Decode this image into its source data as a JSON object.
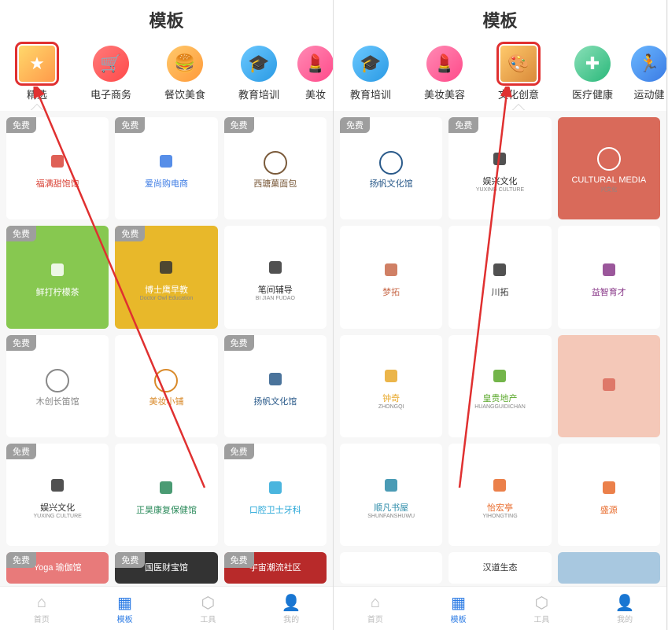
{
  "left": {
    "title": "模板",
    "categories": [
      {
        "label": "精选",
        "color": "linear-gradient(135deg,#ffd86b,#ff9a4a)",
        "glyph": "★",
        "selected": true
      },
      {
        "label": "电子商务",
        "color": "linear-gradient(135deg,#ff7a7a,#ff4a4a)",
        "glyph": "🛒"
      },
      {
        "label": "餐饮美食",
        "color": "linear-gradient(135deg,#ffc96b,#ff9a3a)",
        "glyph": "🍔"
      },
      {
        "label": "教育培训",
        "color": "linear-gradient(135deg,#6bc8ff,#2a9ae4)",
        "glyph": "🎓"
      },
      {
        "label": "美妆",
        "color": "linear-gradient(135deg,#ff8ab4,#ff4a8a)",
        "glyph": "💄",
        "partial": true
      }
    ],
    "free_badge": "免费",
    "cards": [
      {
        "bg": "#fff",
        "title": "福满甜饱饱",
        "accent": "#d94438",
        "badge": true
      },
      {
        "bg": "#fff",
        "title": "爱尚购电商",
        "accent": "#3a7ae4",
        "badge": true
      },
      {
        "bg": "#fff",
        "title": "西瑭菓面包",
        "accent": "#7a5a3a",
        "badge": true,
        "circle": true
      },
      {
        "bg": "#87c850",
        "title": "鲜打柠檬茶",
        "accent": "#fff",
        "badge": true
      },
      {
        "bg": "#e8b82a",
        "title": "博士鹰早教",
        "sub": "Doctor Owl Education",
        "accent": "#333",
        "badge": true
      },
      {
        "bg": "#fff",
        "title": "笔间辅导",
        "sub": "BI JIAN FUDAO",
        "accent": "#333"
      },
      {
        "bg": "#fff",
        "title": "木创长笛馆",
        "accent": "#888",
        "badge": true,
        "circle": true
      },
      {
        "bg": "#fff",
        "title": "美妆小铺",
        "accent": "#d98a2a",
        "circle": true
      },
      {
        "bg": "#fff",
        "title": "扬帆文化馆",
        "accent": "#2a5a8a",
        "badge": true
      },
      {
        "bg": "#fff",
        "title": "娱兴文化",
        "sub": "YUXING CULTURE",
        "accent": "#333",
        "badge": true
      },
      {
        "bg": "#fff",
        "title": "正昊康复保健馆",
        "accent": "#2a8a5a"
      },
      {
        "bg": "#fff",
        "title": "口腔卫士牙科",
        "accent": "#2aa8d8",
        "badge": true
      },
      {
        "bg": "#e87a7a",
        "title": "Yoga 瑜伽馆",
        "accent": "#fff",
        "badge": true,
        "short": true
      },
      {
        "bg": "#333",
        "title": "国医财宝馆",
        "accent": "#e8b82a",
        "badge": true,
        "short": true
      },
      {
        "bg": "#b82a2a",
        "title": "宇宙潮流社区",
        "accent": "#fff",
        "badge": true,
        "short": true
      }
    ]
  },
  "right": {
    "title": "模板",
    "categories": [
      {
        "label": "教育培训",
        "color": "linear-gradient(135deg,#6bc8ff,#2a9ae4)",
        "glyph": "🎓",
        "partial_left": true
      },
      {
        "label": "美妆美容",
        "color": "linear-gradient(135deg,#ff8ab4,#ff4a8a)",
        "glyph": "💄"
      },
      {
        "label": "文化创意",
        "color": "linear-gradient(135deg,#ffc96b,#d98a3a)",
        "glyph": "🎨",
        "selected": true
      },
      {
        "label": "医疗健康",
        "color": "linear-gradient(135deg,#8ae0b8,#2ab87a)",
        "glyph": "✚"
      },
      {
        "label": "运动健",
        "color": "linear-gradient(135deg,#6bb8ff,#3a7ae4)",
        "glyph": "🏃",
        "partial": true
      }
    ],
    "free_badge": "免费",
    "cards": [
      {
        "bg": "#fff",
        "title": "扬帆文化馆",
        "accent": "#2a5a8a",
        "badge": true,
        "circle": true
      },
      {
        "bg": "#fff",
        "title": "娱兴文化",
        "sub": "YUXING CULTURE",
        "accent": "#333",
        "badge": true
      },
      {
        "bg": "#d96a5a",
        "title": "CULTURAL MEDIA",
        "sub": "兴文化",
        "accent": "#fff",
        "circle_white": true
      },
      {
        "bg": "#fff",
        "title": "梦拓",
        "accent": "#c86a4a"
      },
      {
        "bg": "#fff",
        "title": "川拓",
        "accent": "#333"
      },
      {
        "bg": "#fff",
        "title": "益智育才",
        "accent": "#8a3a8a"
      },
      {
        "bg": "#fff",
        "title": "钟奇",
        "sub": "ZHONGQI",
        "accent": "#e8a82a"
      },
      {
        "bg": "#fff",
        "title": "皇贵地产",
        "sub": "HUANGGUIDICHAN",
        "accent": "#5aa82a"
      },
      {
        "bg": "#f4c8b8",
        "title": "",
        "accent": "#d96a5a"
      },
      {
        "bg": "#fff",
        "title": "顺凡书屋",
        "sub": "SHUNFANSHUWU",
        "accent": "#2a8aa8"
      },
      {
        "bg": "#fff",
        "title": "怡宏亭",
        "sub": "YIHONGTING",
        "accent": "#e86a2a"
      },
      {
        "bg": "#fff",
        "title": "盛源",
        "accent": "#e86a2a"
      },
      {
        "bg": "#fff",
        "title": "",
        "accent": "#e8a82a",
        "short": true
      },
      {
        "bg": "#fff",
        "title": "汉道生态",
        "accent": "#333",
        "short": true
      },
      {
        "bg": "#a8c8e0",
        "title": "",
        "accent": "#fff",
        "short": true
      }
    ]
  },
  "tabbar": {
    "items": [
      {
        "label": "首页",
        "glyph": "⌂"
      },
      {
        "label": "模板",
        "glyph": "▦",
        "active": true
      },
      {
        "label": "工具",
        "glyph": "⬡"
      },
      {
        "label": "我的",
        "glyph": "👤"
      }
    ]
  }
}
